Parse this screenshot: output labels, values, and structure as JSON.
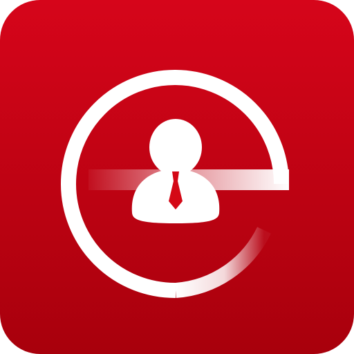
{
  "icon": {
    "name": "e-person-app-icon",
    "glyph": "e",
    "colors": {
      "background_top": "#d6051a",
      "background_bottom": "#a8000c",
      "glyph": "#ffffff",
      "tie": "#d40816"
    }
  }
}
